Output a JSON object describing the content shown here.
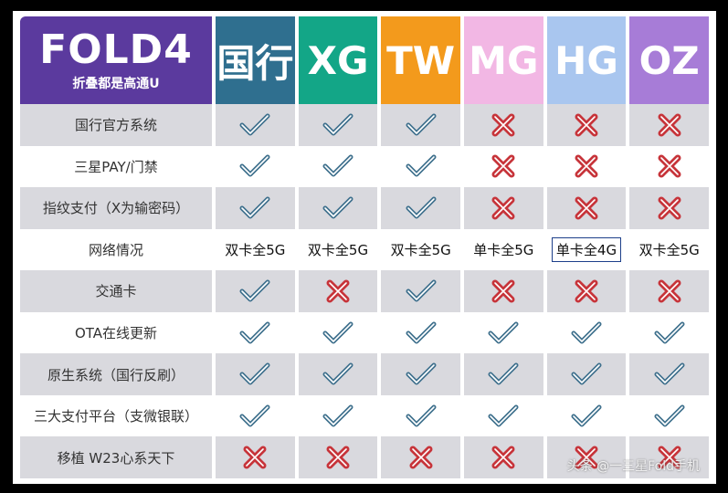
{
  "colors": {
    "logo": "#5b3a9e",
    "guohang": "#2f6f8f",
    "xg": "#13a687",
    "tw": "#f39a1c",
    "mg": "#f2b7e4",
    "hg": "#a9c6ef",
    "oz": "#a77cd7",
    "check": "#3d6f8c",
    "cross": "#c7343a",
    "shade": "#d9d9de"
  },
  "logo": {
    "title": "FOLD4",
    "subtitle": "折叠都是高通U"
  },
  "columns": [
    "国行",
    "XG",
    "TW",
    "MG",
    "HG",
    "OZ"
  ],
  "rows": [
    {
      "label": "国行官方系统",
      "cells": [
        "check",
        "check",
        "check",
        "cross",
        "cross",
        "cross"
      ]
    },
    {
      "label": "三星PAY/门禁",
      "cells": [
        "check",
        "check",
        "check",
        "cross",
        "cross",
        "cross"
      ]
    },
    {
      "label": "指纹支付（X为输密码）",
      "cells": [
        "check",
        "check",
        "check",
        "cross",
        "cross",
        "cross"
      ]
    },
    {
      "label": "网络情况",
      "cells": [
        "双卡全5G",
        "双卡全5G",
        "双卡全5G",
        "单卡全5G",
        "单卡全4G",
        "双卡全5G"
      ],
      "text_row": true,
      "boxed_index": 4
    },
    {
      "label": "交通卡",
      "cells": [
        "check",
        "cross",
        "check",
        "cross",
        "cross",
        "cross"
      ]
    },
    {
      "label": "OTA在线更新",
      "cells": [
        "check",
        "check",
        "check",
        "check",
        "check",
        "check"
      ]
    },
    {
      "label": "原生系统（国行反刷）",
      "cells": [
        "check",
        "check",
        "check",
        "check",
        "check",
        "check"
      ]
    },
    {
      "label": "三大支付平台（支微银联）",
      "cells": [
        "check",
        "check",
        "check",
        "check",
        "check",
        "check"
      ]
    },
    {
      "label": "移植 W23心系天下",
      "cells": [
        "cross",
        "cross",
        "cross",
        "cross",
        "cross",
        "cross"
      ]
    }
  ],
  "watermark": "头条 @一三星Fold手机"
}
